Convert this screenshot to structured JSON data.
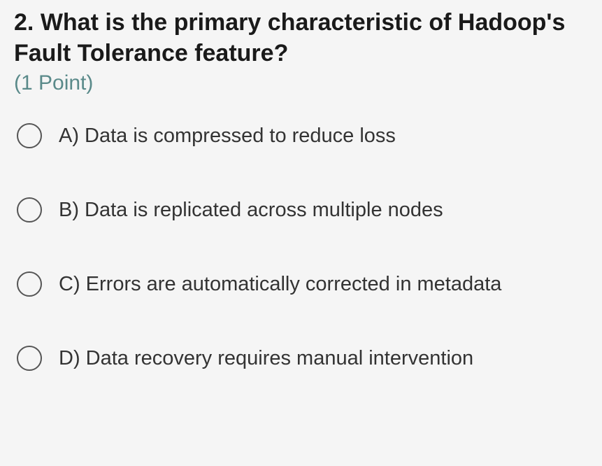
{
  "question": {
    "number": "2.",
    "text": "What is the primary characteristic of Hadoop's Fault Tolerance feature?",
    "points": "(1 Point)"
  },
  "options": [
    {
      "label": "A) Data is compressed to reduce loss"
    },
    {
      "label": "B) Data is replicated across multiple nodes"
    },
    {
      "label": "C) Errors are automatically corrected in metadata"
    },
    {
      "label": "D) Data recovery requires manual intervention"
    }
  ]
}
